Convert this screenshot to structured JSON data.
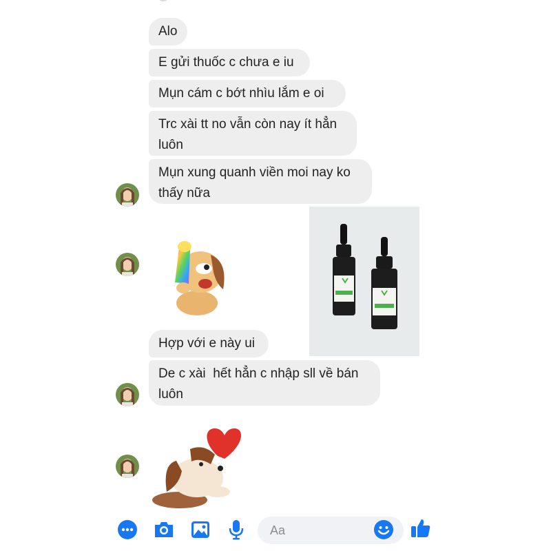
{
  "messages": [
    {
      "text": "Alo"
    },
    {
      "text": "E gửi thuốc c chưa e iu"
    },
    {
      "text": "Mụn cám c bớt nhìu lắm e oi"
    },
    {
      "text": "Trc xài tt no vẫn còn nay ít hẳn\nluôn"
    },
    {
      "text": "Mụn xung quanh viền moi nay ko\nthấy nữa"
    },
    {
      "text": "Hợp với e này ui"
    },
    {
      "text": "De c xài  hết hẳn c nhập sll về bán\nluôn"
    }
  ],
  "composer": {
    "placeholder": "Aa",
    "icons": [
      "more-icon",
      "camera-icon",
      "gallery-icon",
      "microphone-icon",
      "emoji-icon",
      "thumbs-up-icon"
    ],
    "accent_color": "#1877f2"
  },
  "colors": {
    "bubble": "#eeeeee",
    "accent": "#1877f2"
  }
}
